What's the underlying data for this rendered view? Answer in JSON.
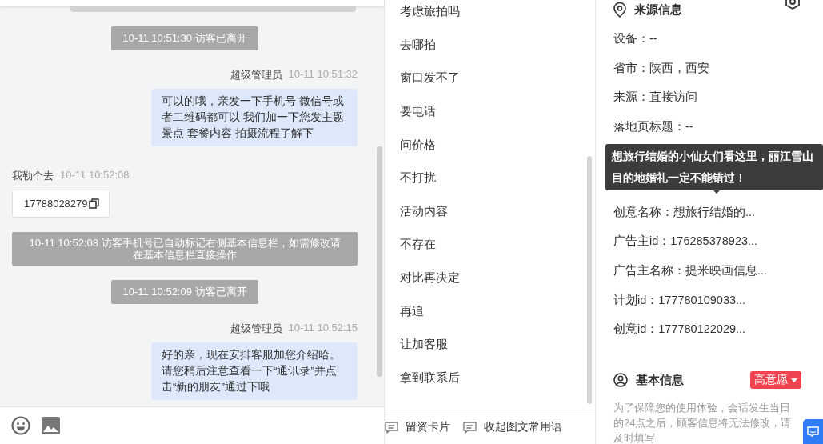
{
  "chat": {
    "messages": [
      {
        "kind": "system",
        "text": "10-11 10:51:30 访客已离开"
      },
      {
        "kind": "agent",
        "sender": "超级管理员",
        "time": "10-11 10:51:32",
        "text": "可以的哦，亲发一下手机号 微信号或者二维码都可以 我们加一下您发主题景点 套餐内容 拍摄流程了解下"
      },
      {
        "kind": "visitor_card",
        "sender": "我勒个去",
        "time": "10-11 10:52:08",
        "text": "17788028279"
      },
      {
        "kind": "notice",
        "text": "10-11 10:52:08 访客手机号已自动标记右侧基本信息栏，如需修改请在基本信息栏直接操作"
      },
      {
        "kind": "system",
        "text": "10-11 10:52:09 访客已离开"
      },
      {
        "kind": "agent",
        "sender": "超级管理员",
        "time": "10-11 10:52:15",
        "text": "好的亲，现在安排客服加您介绍哈。请您稍后注意查看一下“通讯录”并点击“新的朋友”通过下哦"
      }
    ]
  },
  "quick_replies": {
    "items": [
      "考虑旅拍吗",
      "去哪拍",
      "窗口发不了",
      "要电话",
      "问价格",
      "不打扰",
      "活动内容",
      "不存在",
      "对比再决定",
      "再追",
      "让加客服",
      "拿到联系后"
    ],
    "buttons": [
      "留资卡片",
      "收起图文常用语"
    ]
  },
  "source_info": {
    "title": "来源信息",
    "rows_before": [
      "设备：--",
      "省市：陕西，西安",
      "来源：直接访问",
      "落地页标题：--"
    ],
    "tooltip": "想旅行结婚的小仙女们看这里，丽江雪山目的地婚礼一定不能错过！",
    "rows_after": [
      "创意名称：想旅行结婚的...",
      "广告主id：176285378923...",
      "广告主名称：提米映画信息...",
      "计划id：177780109033...",
      "创意id：177780122029..."
    ]
  },
  "basic_info": {
    "title": "基本信息",
    "tag": "高意愿",
    "note": "为了保障您的使用体验，会话发生当日的24点之后，顾客信息将无法修改，请及时填写"
  }
}
